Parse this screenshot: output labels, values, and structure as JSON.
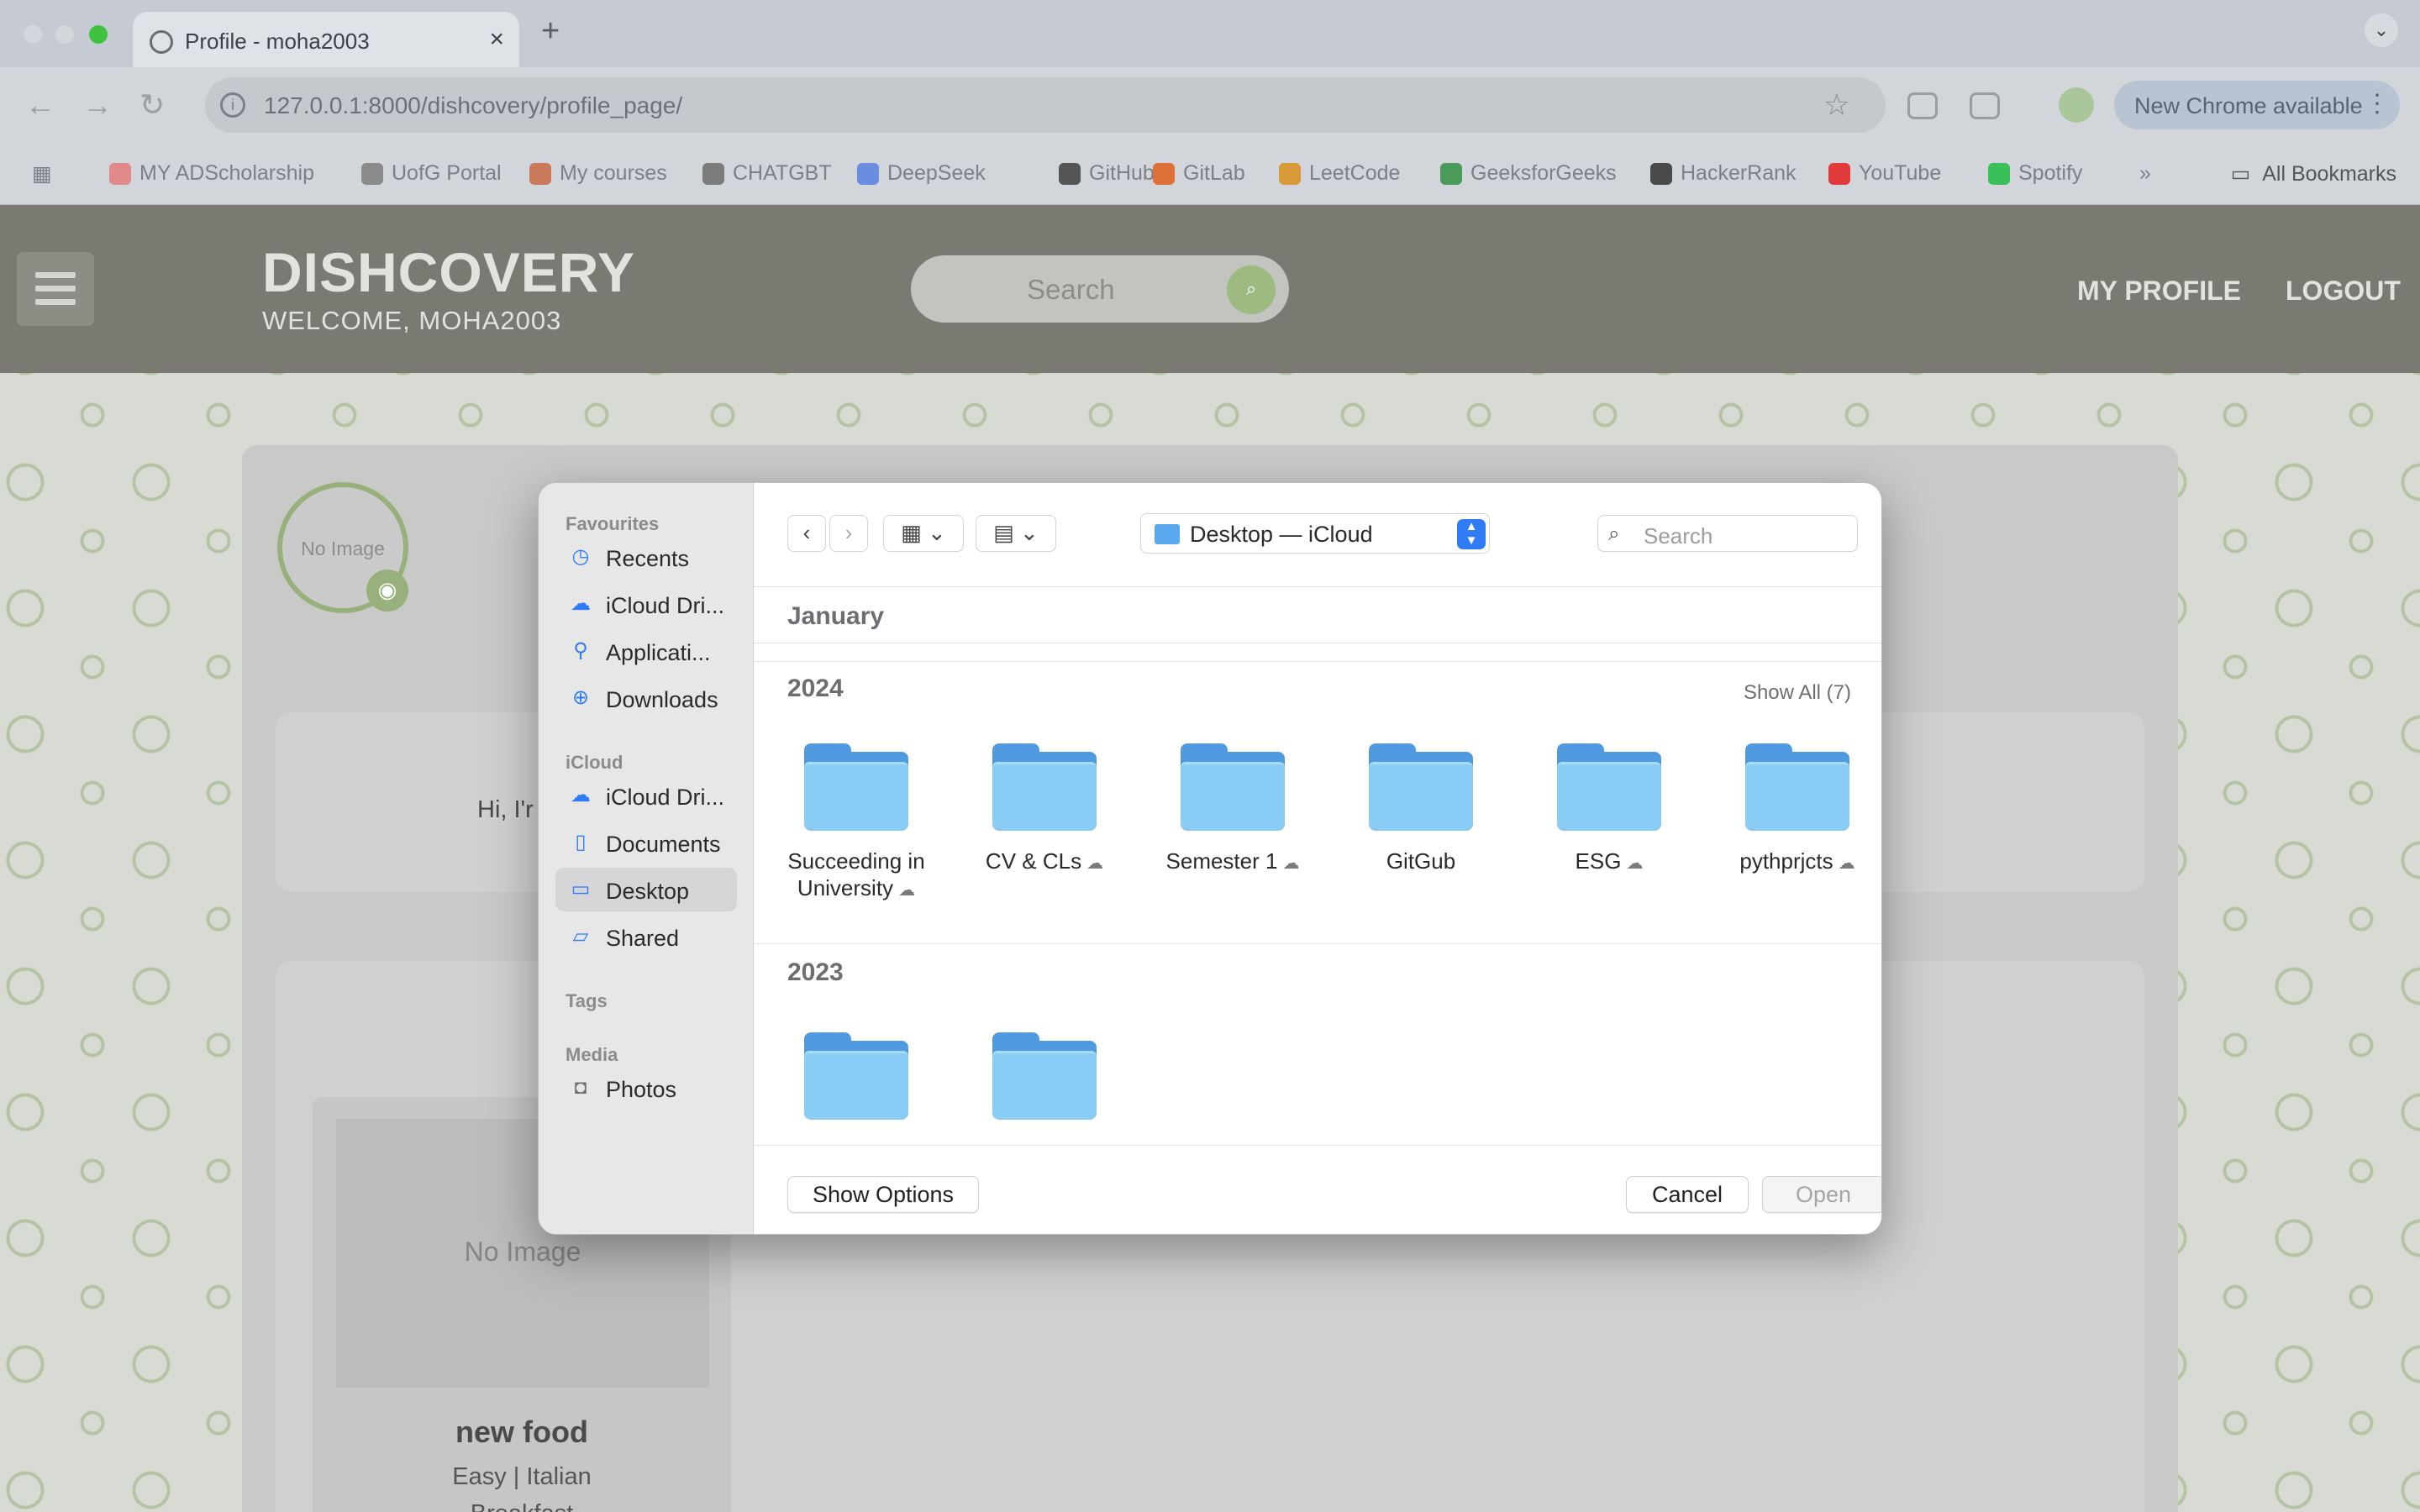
{
  "browser": {
    "tab_title": "Profile - moha2003",
    "url": "127.0.0.1:8000/dishcovery/profile_page/",
    "update_label": "New Chrome available",
    "bookmarks": [
      {
        "label": "MY ADScholarship",
        "color": "#e08a8a"
      },
      {
        "label": "UofG Portal",
        "color": "#8b8b8b"
      },
      {
        "label": "My courses",
        "color": "#c97a5a"
      },
      {
        "label": "CHATGBT",
        "color": "#7c7c7c"
      },
      {
        "label": "DeepSeek",
        "color": "#6b8de0"
      },
      {
        "label": "GitHub",
        "color": "#555555"
      },
      {
        "label": "GitLab",
        "color": "#e0703a"
      },
      {
        "label": "LeetCode",
        "color": "#d99a3a"
      },
      {
        "label": "GeeksforGeeks",
        "color": "#4a9a5a"
      },
      {
        "label": "HackerRank",
        "color": "#4a4a4a"
      },
      {
        "label": "YouTube",
        "color": "#e03a3a"
      },
      {
        "label": "Spotify",
        "color": "#3ac05a"
      }
    ],
    "all_bookmarks": "All Bookmarks"
  },
  "site": {
    "brand": "DISHCOVERY",
    "welcome": "WELCOME, MOHA2003",
    "search_placeholder": "Search",
    "nav": {
      "profile": "MY PROFILE",
      "logout": "LOGOUT"
    },
    "avatar_text": "No Image",
    "bio_text": "Hi, I'r",
    "recipe": {
      "image_text": "No Image",
      "title": "new food",
      "tags": "Easy | Italian",
      "meal": "Breakfast"
    }
  },
  "dialog": {
    "sidebar": {
      "favourites_label": "Favourites",
      "favourites": [
        {
          "label": "Recents",
          "icon": "clock-icon"
        },
        {
          "label": "iCloud Dri...",
          "icon": "cloud-icon"
        },
        {
          "label": "Applicati...",
          "icon": "apps-icon"
        },
        {
          "label": "Downloads",
          "icon": "download-icon"
        }
      ],
      "icloud_label": "iCloud",
      "icloud": [
        {
          "label": "iCloud Dri...",
          "icon": "cloud-icon"
        },
        {
          "label": "Documents",
          "icon": "document-icon"
        },
        {
          "label": "Desktop",
          "icon": "desktop-icon"
        },
        {
          "label": "Shared",
          "icon": "shared-folder-icon"
        }
      ],
      "tags_label": "Tags",
      "media_label": "Media",
      "media": [
        {
          "label": "Photos",
          "icon": "camera-icon"
        }
      ]
    },
    "location": "Desktop — iCloud",
    "search_placeholder": "Search",
    "groups": {
      "january": "January",
      "y2024": "2024",
      "show_all": "Show All (7)",
      "y2023": "2023"
    },
    "folders_2024": [
      {
        "name1": "Succeeding in",
        "name2": "University",
        "cloud": true
      },
      {
        "name1": "CV & CLs",
        "name2": "",
        "cloud": true
      },
      {
        "name1": "Semester 1",
        "name2": "",
        "cloud": true
      },
      {
        "name1": "GitGub",
        "name2": "",
        "cloud": false
      },
      {
        "name1": "ESG",
        "name2": "",
        "cloud": true
      },
      {
        "name1": "pythprjcts",
        "name2": "",
        "cloud": true
      }
    ],
    "buttons": {
      "show_options": "Show Options",
      "cancel": "Cancel",
      "open": "Open"
    }
  }
}
